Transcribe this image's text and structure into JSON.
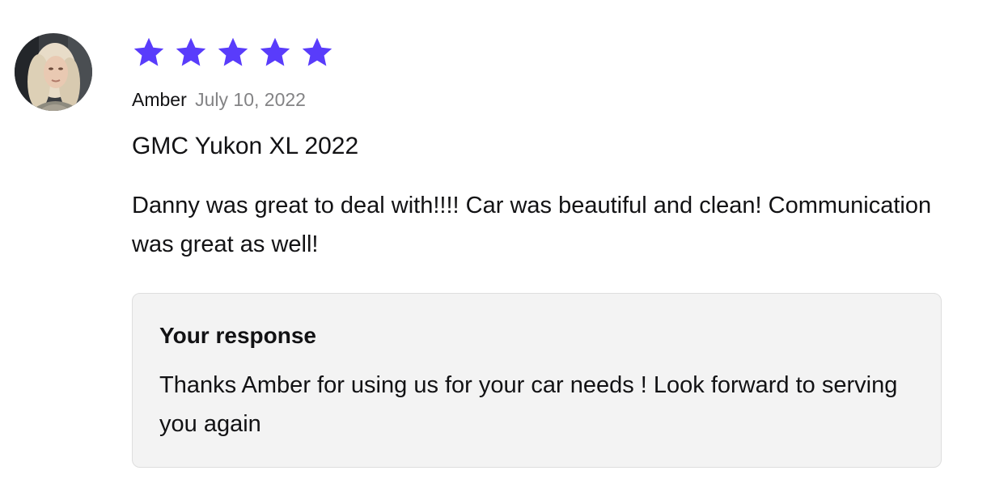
{
  "review": {
    "rating": 5,
    "rating_max": 5,
    "star_color": "#593cfb",
    "author": "Amber",
    "date": "July 10, 2022",
    "vehicle": "GMC Yukon XL 2022",
    "text": "Danny was great to deal with!!!! Car was beautiful and clean! Communication was great as well!"
  },
  "response": {
    "title": "Your response",
    "text": "Thanks Amber for using us for your car needs ! Look forward to serving you again"
  }
}
